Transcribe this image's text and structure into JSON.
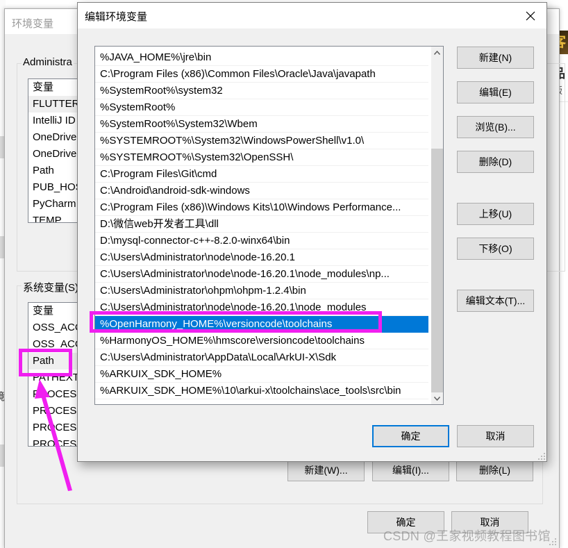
{
  "parent_dialog": {
    "title": "环境变量",
    "user_group_label": "Administra",
    "user_vars": {
      "header": "变量",
      "rows": [
        "FLUTTER_",
        "IntelliJ ID",
        "OneDrive",
        "OneDrive",
        "Path",
        "PUB_HOS",
        "PyCharm",
        "TEMP"
      ]
    },
    "system_group_label": "系统变量(S)",
    "system_vars": {
      "header": "变量",
      "rows": [
        "OSS_ACC",
        "OSS_ACC",
        "Path",
        "PATHEXT",
        "PROCESS",
        "PROCESS",
        "PROCESS",
        "PROCESS"
      ],
      "highlighted": "Path"
    },
    "system_buttons": {
      "new": "新建(W)...",
      "edit": "编辑(I)...",
      "delete": "删除(L)"
    },
    "ok": "确定",
    "cancel": "取消"
  },
  "edit_dialog": {
    "title": "编辑环境变量",
    "paths": [
      "%JAVA_HOME%\\jre\\bin",
      "C:\\Program Files (x86)\\Common Files\\Oracle\\Java\\javapath",
      "%SystemRoot%\\system32",
      "%SystemRoot%",
      "%SystemRoot%\\System32\\Wbem",
      "%SYSTEMROOT%\\System32\\WindowsPowerShell\\v1.0\\",
      "%SYSTEMROOT%\\System32\\OpenSSH\\",
      "C:\\Program Files\\Git\\cmd",
      "C:\\Android\\android-sdk-windows",
      "C:\\Program Files (x86)\\Windows Kits\\10\\Windows Performance...",
      "D:\\微信web开发者工具\\dll",
      "D:\\mysql-connector-c++-8.2.0-winx64\\bin",
      "C:\\Users\\Administrator\\node\\node-16.20.1",
      "C:\\Users\\Administrator\\node\\node-16.20.1\\node_modules\\np...",
      "C:\\Users\\Administrator\\ohpm\\ohpm-1.2.4\\bin",
      "C:\\Users\\Administrator\\node\\node-16.20.1\\node_modules",
      "%OpenHarmony_HOME%\\versioncode\\toolchains",
      "%HarmonyOS_HOME%\\hmscore\\versioncode\\toolchains",
      "C:\\Users\\Administrator\\AppData\\Local\\ArkUI-X\\Sdk",
      "%ARKUIX_SDK_HOME%",
      "%ARKUIX_SDK_HOME%\\10\\arkui-x\\toolchains\\ace_tools\\src\\bin"
    ],
    "selected_index": 16,
    "scroll_position": 0.27,
    "scroll_visible_fraction": 0.73,
    "buttons": {
      "new": "新建(N)",
      "edit": "编辑(E)",
      "browse": "浏览(B)...",
      "delete": "删除(D)",
      "move_up": "上移(U)",
      "move_down": "下移(O)",
      "edit_text": "编辑文本(T)..."
    },
    "ok": "确定",
    "cancel": "取消"
  },
  "background": {
    "banner_text": "客",
    "side_text_1": "品",
    "side_text_2": "版",
    "left_fragment": "境"
  },
  "annotation_color": "#f01ff0",
  "selection_color": "#0078d7",
  "watermark": "CSDN @王家视频教程图书馆"
}
